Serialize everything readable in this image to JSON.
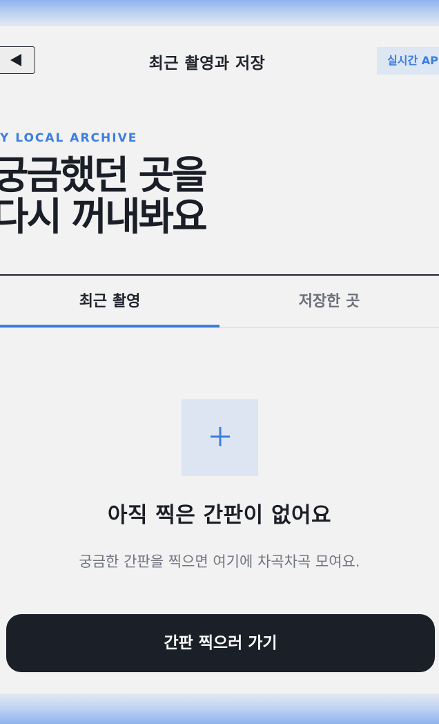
{
  "header": {
    "back_icon": "back-arrow-icon",
    "title": "최근 촬영과 저장",
    "live_badge": "실시간 API"
  },
  "hero": {
    "eyebrow": "Y LOCAL ARCHIVE",
    "title_line1": "궁금했던 곳을",
    "title_line2": "다시 꺼내봐요"
  },
  "tabs": [
    {
      "label": "최근 촬영",
      "selected": true
    },
    {
      "label": "저장한 곳",
      "selected": false
    }
  ],
  "empty_state": {
    "icon": "plus-icon",
    "title": "아직 찍은 간판이 없어요",
    "description": "궁금한 간판을 찍으면 여기에 차곡차곡 모여요.",
    "cta_label": "간판 찍으러 가기"
  },
  "colors": {
    "accent": "#3b7ee0",
    "dark": "#1b1f27",
    "background": "#f2f2f2",
    "tile": "#dce5f1"
  }
}
